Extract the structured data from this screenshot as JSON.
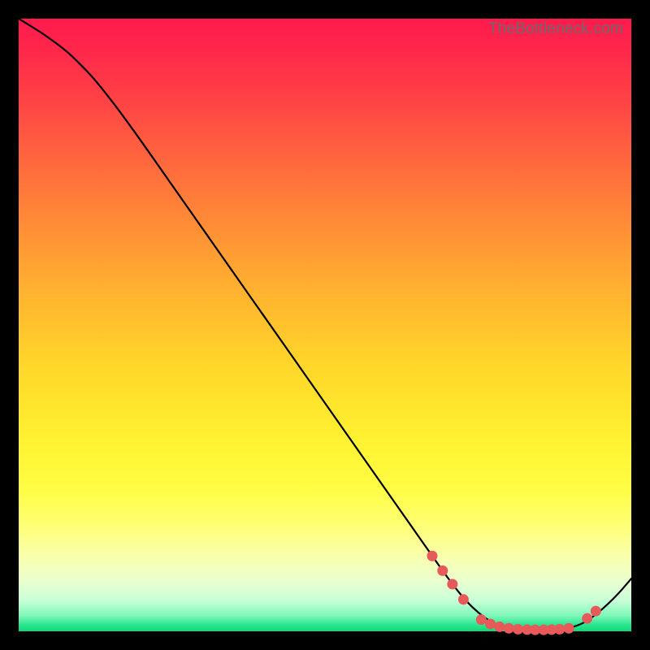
{
  "attribution": "TheBottleneck.com",
  "colors": {
    "frame": "#000000",
    "marker": "#e85a5a",
    "curve": "#000000"
  },
  "chart_data": {
    "type": "line",
    "title": "",
    "xlabel": "",
    "ylabel": "",
    "xlim": [
      0,
      100
    ],
    "ylim": [
      0,
      100
    ],
    "grid": false,
    "legend": false,
    "note": "Bottleneck-style curve. y is read as percent of plot height from bottom (0=bottom, 100=top). x is percent of plot width from left. Values estimated from pixels.",
    "series": [
      {
        "name": "curve",
        "x": [
          0,
          4,
          8,
          12,
          16,
          20,
          24,
          28,
          32,
          36,
          40,
          44,
          48,
          52,
          56,
          60,
          64,
          68,
          70,
          72,
          74,
          76,
          78,
          80,
          82,
          84,
          86,
          88,
          90,
          92,
          94,
          96,
          98,
          100
        ],
        "y": [
          100,
          97.5,
          94.5,
          90.5,
          85.5,
          80,
          74.3,
          68.6,
          62.9,
          57.2,
          51.5,
          45.8,
          40.1,
          34.4,
          28.7,
          23,
          17.3,
          11.6,
          8.8,
          6.2,
          4.0,
          2.3,
          1.1,
          0.5,
          0.25,
          0.2,
          0.2,
          0.3,
          0.6,
          1.3,
          2.6,
          4.3,
          6.3,
          8.6
        ]
      }
    ],
    "markers": {
      "name": "highlight-points",
      "x": [
        67.5,
        69.2,
        70.8,
        72.6,
        75.5,
        77.0,
        78.5,
        80.0,
        81.5,
        83.0,
        84.3,
        85.7,
        87.0,
        88.3,
        89.8,
        92.8,
        94.2
      ],
      "y": [
        12.3,
        9.9,
        7.7,
        5.2,
        1.9,
        1.2,
        0.75,
        0.5,
        0.35,
        0.28,
        0.25,
        0.25,
        0.28,
        0.35,
        0.5,
        2.1,
        3.3
      ],
      "radius": 6.5
    }
  }
}
